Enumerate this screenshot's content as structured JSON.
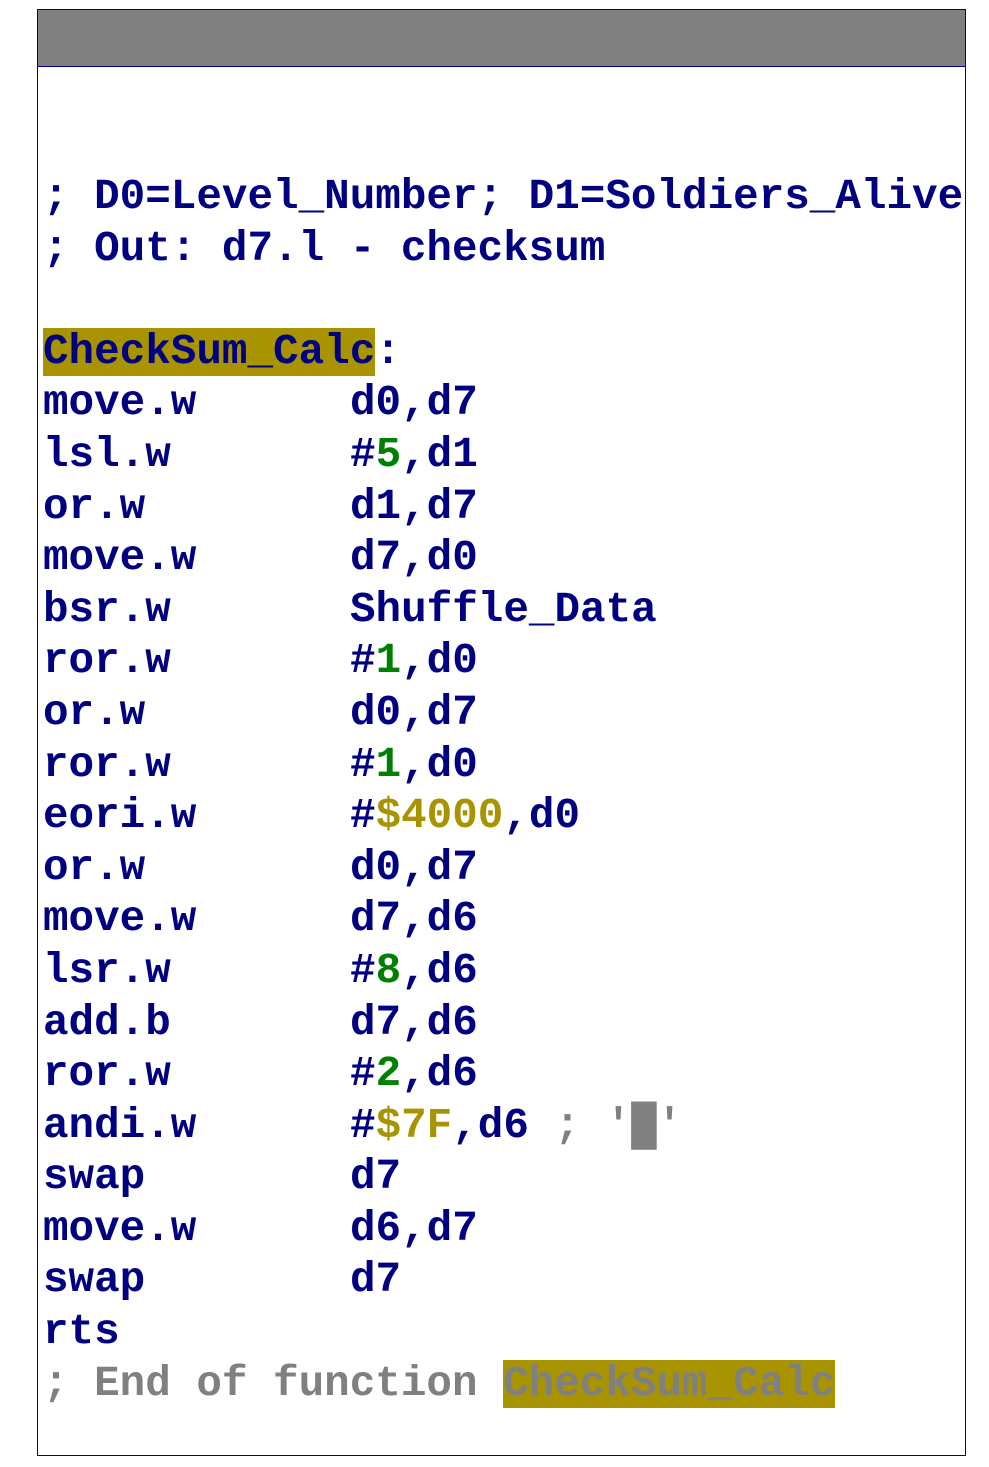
{
  "colors": {
    "text": "#000080",
    "number": "#008000",
    "hex": "#a89400",
    "comment_gray": "#808080",
    "highlight": "#a89400",
    "titlebar": "#808080"
  },
  "lines": [
    {
      "segments": [
        {
          "t": "; D0=Level_Number; D1=Soldiers_Alive",
          "c": "c-comment"
        }
      ]
    },
    {
      "segments": [
        {
          "t": "; Out: d7.l - checksum",
          "c": "c-comment"
        }
      ]
    },
    {
      "segments": []
    },
    {
      "segments": [
        {
          "t": "CheckSum_Calc",
          "c": "hl"
        },
        {
          "t": ":",
          "c": ""
        }
      ]
    },
    {
      "mnemonic": "move.w",
      "segments": [
        {
          "t": "d0,d7",
          "c": ""
        }
      ]
    },
    {
      "mnemonic": "lsl.w",
      "segments": [
        {
          "t": "#",
          "c": ""
        },
        {
          "t": "5",
          "c": "c-num"
        },
        {
          "t": ",d1",
          "c": ""
        }
      ]
    },
    {
      "mnemonic": "or.w",
      "segments": [
        {
          "t": "d1,d7",
          "c": ""
        }
      ]
    },
    {
      "mnemonic": "move.w",
      "segments": [
        {
          "t": "d7,d0",
          "c": ""
        }
      ]
    },
    {
      "mnemonic": "bsr.w",
      "segments": [
        {
          "t": "Shuffle_Data",
          "c": ""
        }
      ]
    },
    {
      "mnemonic": "ror.w",
      "segments": [
        {
          "t": "#",
          "c": ""
        },
        {
          "t": "1",
          "c": "c-num"
        },
        {
          "t": ",d0",
          "c": ""
        }
      ]
    },
    {
      "mnemonic": "or.w",
      "segments": [
        {
          "t": "d0,d7",
          "c": ""
        }
      ]
    },
    {
      "mnemonic": "ror.w",
      "segments": [
        {
          "t": "#",
          "c": ""
        },
        {
          "t": "1",
          "c": "c-num"
        },
        {
          "t": ",d0",
          "c": ""
        }
      ]
    },
    {
      "mnemonic": "eori.w",
      "segments": [
        {
          "t": "#",
          "c": ""
        },
        {
          "t": "$4000",
          "c": "c-hex"
        },
        {
          "t": ",d0",
          "c": ""
        }
      ]
    },
    {
      "mnemonic": "or.w",
      "segments": [
        {
          "t": "d0,d7",
          "c": ""
        }
      ]
    },
    {
      "mnemonic": "move.w",
      "segments": [
        {
          "t": "d7,d6",
          "c": ""
        }
      ]
    },
    {
      "mnemonic": "lsr.w",
      "segments": [
        {
          "t": "#",
          "c": ""
        },
        {
          "t": "8",
          "c": "c-num"
        },
        {
          "t": ",d6",
          "c": ""
        }
      ]
    },
    {
      "mnemonic": "add.b",
      "segments": [
        {
          "t": "d7,d6",
          "c": ""
        }
      ]
    },
    {
      "mnemonic": "ror.w",
      "segments": [
        {
          "t": "#",
          "c": ""
        },
        {
          "t": "2",
          "c": "c-num"
        },
        {
          "t": ",d6",
          "c": ""
        }
      ]
    },
    {
      "mnemonic": "andi.w",
      "segments": [
        {
          "t": "#",
          "c": ""
        },
        {
          "t": "$7F",
          "c": "c-hex"
        },
        {
          "t": ",d6",
          "c": ""
        },
        {
          "t": " ; '█'",
          "c": "c-gray"
        }
      ]
    },
    {
      "mnemonic": "swap",
      "segments": [
        {
          "t": "d7",
          "c": ""
        }
      ]
    },
    {
      "mnemonic": "move.w",
      "segments": [
        {
          "t": "d6,d7",
          "c": ""
        }
      ]
    },
    {
      "mnemonic": "swap",
      "segments": [
        {
          "t": "d7",
          "c": ""
        }
      ]
    },
    {
      "mnemonic": "rts",
      "segments": []
    },
    {
      "segments": [
        {
          "t": "; End of function ",
          "c": "c-gray"
        },
        {
          "t": "CheckSum_Calc",
          "c": "c-gray hl"
        }
      ]
    }
  ]
}
